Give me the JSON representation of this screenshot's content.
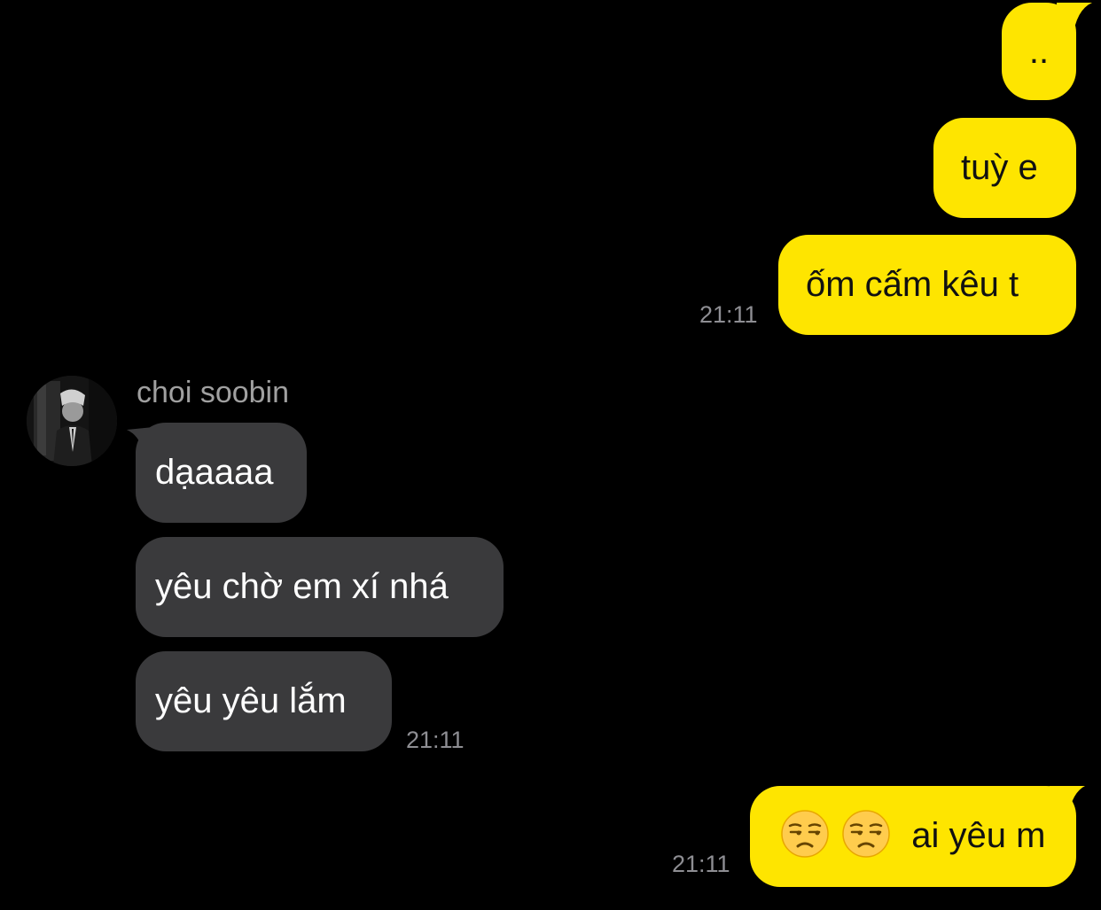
{
  "colors": {
    "background": "#000000",
    "outgoing_bubble": "#FEE500",
    "incoming_bubble": "#3a3a3c",
    "timestamp": "#8e8e93"
  },
  "messages": {
    "out_1": "..",
    "out_2": "tuỳ e",
    "out_3": "ốm cấm kêu t",
    "out_3_time": "21:11",
    "sender_name": "choi soobin",
    "avatar_icon": "profile-photo",
    "in_1": "dạaaaa",
    "in_2": "yêu chờ em xí nhá",
    "in_3": "yêu yêu lắm",
    "in_3_time": "21:11",
    "out_4_emoji": [
      "unamused-face",
      "unamused-face"
    ],
    "out_4": "ai yêu m",
    "out_4_time": "21:11"
  }
}
